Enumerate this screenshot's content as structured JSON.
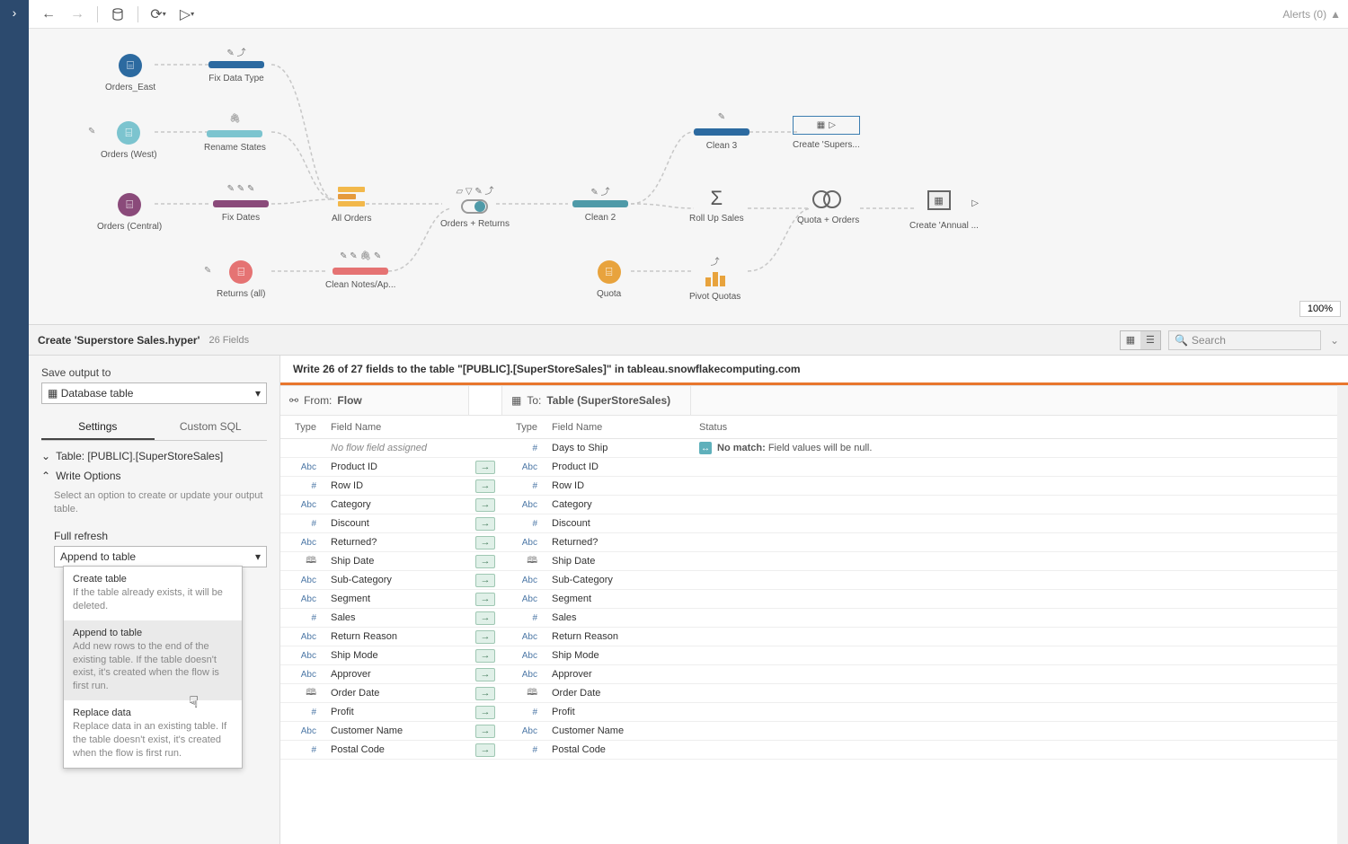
{
  "toolbar": {
    "alerts": "Alerts (0)"
  },
  "canvas": {
    "zoom": "100%",
    "nodes": {
      "orders_east": "Orders_East",
      "orders_west": "Orders (West)",
      "orders_central": "Orders (Central)",
      "returns_all": "Returns (all)",
      "fix_data_type": "Fix Data Type",
      "rename_states": "Rename States",
      "fix_dates": "Fix Dates",
      "all_orders": "All Orders",
      "orders_returns": "Orders + Returns",
      "clean2": "Clean 2",
      "clean_notes": "Clean Notes/Ap...",
      "quota": "Quota",
      "pivot_quotas": "Pivot Quotas",
      "rollup": "Roll Up Sales",
      "clean3": "Clean 3",
      "quota_orders": "Quota + Orders",
      "create_supers": "Create 'Supers...",
      "create_annual": "Create 'Annual ..."
    }
  },
  "pane_header": {
    "title": "Create 'Superstore Sales.hyper'",
    "fields": "26 Fields",
    "search_placeholder": "Search"
  },
  "sidepanel": {
    "save_output_label": "Save output to",
    "save_output_value": "Database table",
    "tab_settings": "Settings",
    "tab_custom_sql": "Custom SQL",
    "table_label": "Table: [PUBLIC].[SuperStoreSales]",
    "write_options": "Write Options",
    "write_hint": "Select an option to create or update your output table.",
    "full_refresh": "Full refresh",
    "append_value": "Append to table",
    "options": [
      {
        "title": "Create table",
        "desc": "If the table already exists, it will be deleted."
      },
      {
        "title": "Append to table",
        "desc": "Add new rows to the end of the existing table. If the table doesn't exist, it's created when the flow is first run."
      },
      {
        "title": "Replace data",
        "desc": "Replace data in an existing table. If the table doesn't exist, it's created when the flow is first run."
      }
    ]
  },
  "mapping": {
    "banner": "Write 26 of 27 fields to the table \"[PUBLIC].[SuperStoreSales]\" in tableau.snowflakecomputing.com",
    "from_label": "From:",
    "from_value": "Flow",
    "to_label": "To:",
    "to_value": "Table (SuperStoreSales)",
    "col_type": "Type",
    "col_field": "Field Name",
    "col_status": "Status",
    "no_flow": "No flow field assigned",
    "status_nomatch_label": "No match:",
    "status_nomatch_text": " Field values will be null.",
    "fields": [
      {
        "fromType": "",
        "fromName": "",
        "toType": "#",
        "toName": "Days to Ship",
        "empty": true,
        "status": "nomatch"
      },
      {
        "fromType": "Abc",
        "fromName": "Product ID",
        "toType": "Abc",
        "toName": "Product ID"
      },
      {
        "fromType": "#",
        "fromName": "Row ID",
        "toType": "#",
        "toName": "Row ID"
      },
      {
        "fromType": "Abc",
        "fromName": "Category",
        "toType": "Abc",
        "toName": "Category"
      },
      {
        "fromType": "#",
        "fromName": "Discount",
        "toType": "#",
        "toName": "Discount"
      },
      {
        "fromType": "Abc",
        "fromName": "Returned?",
        "toType": "Abc",
        "toName": "Returned?"
      },
      {
        "fromType": "date",
        "fromName": "Ship Date",
        "toType": "date",
        "toName": "Ship Date"
      },
      {
        "fromType": "Abc",
        "fromName": "Sub-Category",
        "toType": "Abc",
        "toName": "Sub-Category"
      },
      {
        "fromType": "Abc",
        "fromName": "Segment",
        "toType": "Abc",
        "toName": "Segment"
      },
      {
        "fromType": "#",
        "fromName": "Sales",
        "toType": "#",
        "toName": "Sales"
      },
      {
        "fromType": "Abc",
        "fromName": "Return Reason",
        "toType": "Abc",
        "toName": "Return Reason"
      },
      {
        "fromType": "Abc",
        "fromName": "Ship Mode",
        "toType": "Abc",
        "toName": "Ship Mode"
      },
      {
        "fromType": "Abc",
        "fromName": "Approver",
        "toType": "Abc",
        "toName": "Approver"
      },
      {
        "fromType": "date",
        "fromName": "Order Date",
        "toType": "date",
        "toName": "Order Date"
      },
      {
        "fromType": "#",
        "fromName": "Profit",
        "toType": "#",
        "toName": "Profit"
      },
      {
        "fromType": "Abc",
        "fromName": "Customer Name",
        "toType": "Abc",
        "toName": "Customer Name"
      },
      {
        "fromType": "#",
        "fromName": "Postal Code",
        "toType": "#",
        "toName": "Postal Code"
      }
    ]
  }
}
